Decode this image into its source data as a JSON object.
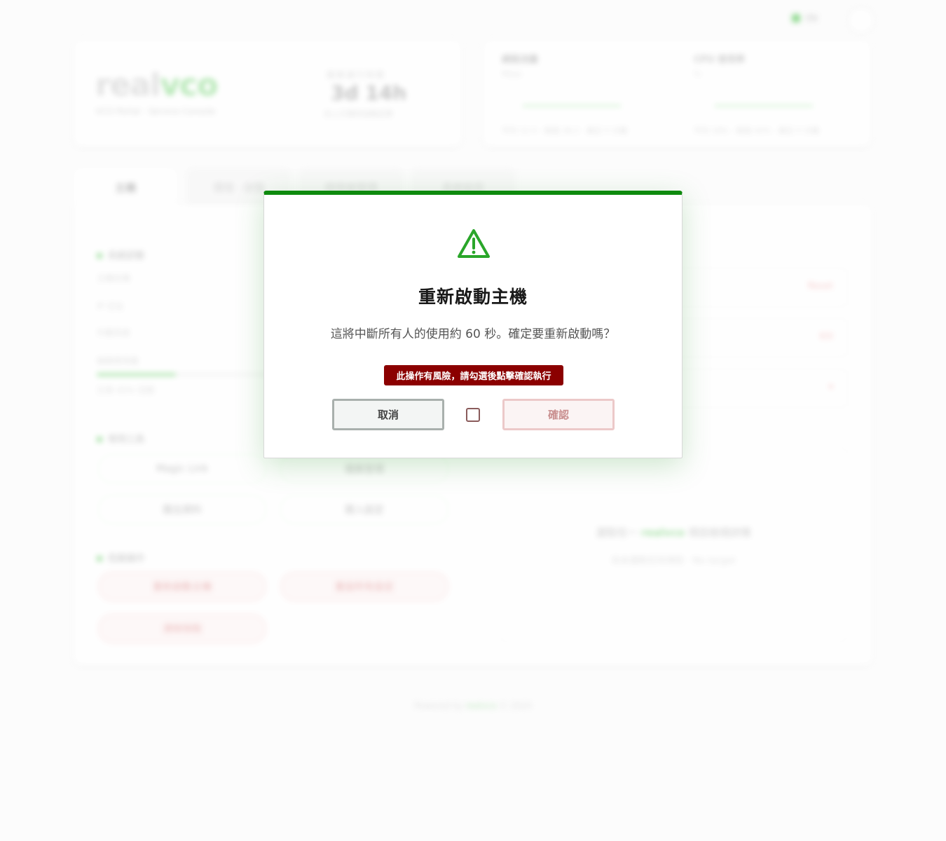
{
  "background": {
    "lang_label": "EN",
    "brand": {
      "logo_dim": "real",
      "logo_accent": "vco",
      "subtitle": "VCO Portal · Service Console",
      "uptime_label": "服務運行時間",
      "uptime_value": "3d 14h",
      "uptime_sub": "自上次重新啟動起算"
    },
    "stats": [
      {
        "title": "網路流量",
        "unit": "Mbps",
        "foot": "平均 12.4 · 峰值 38.2 · 最近 5 分鐘"
      },
      {
        "title": "CPU 使用率",
        "unit": "%",
        "foot": "平均 18% · 峰值 42% · 最近 5 分鐘"
      }
    ],
    "tabs": [
      "主機",
      "環境 · 狀態",
      "使用者管理",
      "系統設定"
    ],
    "sections": {
      "status": "系統狀態",
      "tools": "常用工具",
      "danger": "危險操作"
    },
    "kv": [
      "主機名稱",
      "IP 位址",
      "作業系統",
      "磁碟使用量",
      "已用 45% 空間"
    ],
    "tool_buttons": [
      "Magic Link",
      "檔案管理",
      "匯出資料",
      "匯入設定"
    ],
    "danger_buttons": [
      "重新啟動主機",
      "重設所有設定",
      "清除快取"
    ],
    "right_boxes": [
      "Reset",
      "Kill",
      "▾"
    ],
    "empty_line": [
      "選取任一 ",
      "realvco",
      " 項目檢視詳情"
    ],
    "empty_sub": "尚未選取任何項目 · No target",
    "footer": [
      "Powered by ",
      "realvco",
      " © 2024"
    ]
  },
  "modal": {
    "icon": "warning-triangle-icon",
    "title": "重新啟動主機",
    "message": "這將中斷所有人的使用約 60 秒。確定要重新啟動嗎？",
    "risk_notice": "此操作有風險，請勾選後點擊確認執行",
    "cancel_label": "取消",
    "confirm_label": "確認",
    "confirm_checked": false
  },
  "colors": {
    "accent": "#0e8a0e",
    "icon_green": "#2aa62a",
    "danger_badge": "#8b0000"
  }
}
